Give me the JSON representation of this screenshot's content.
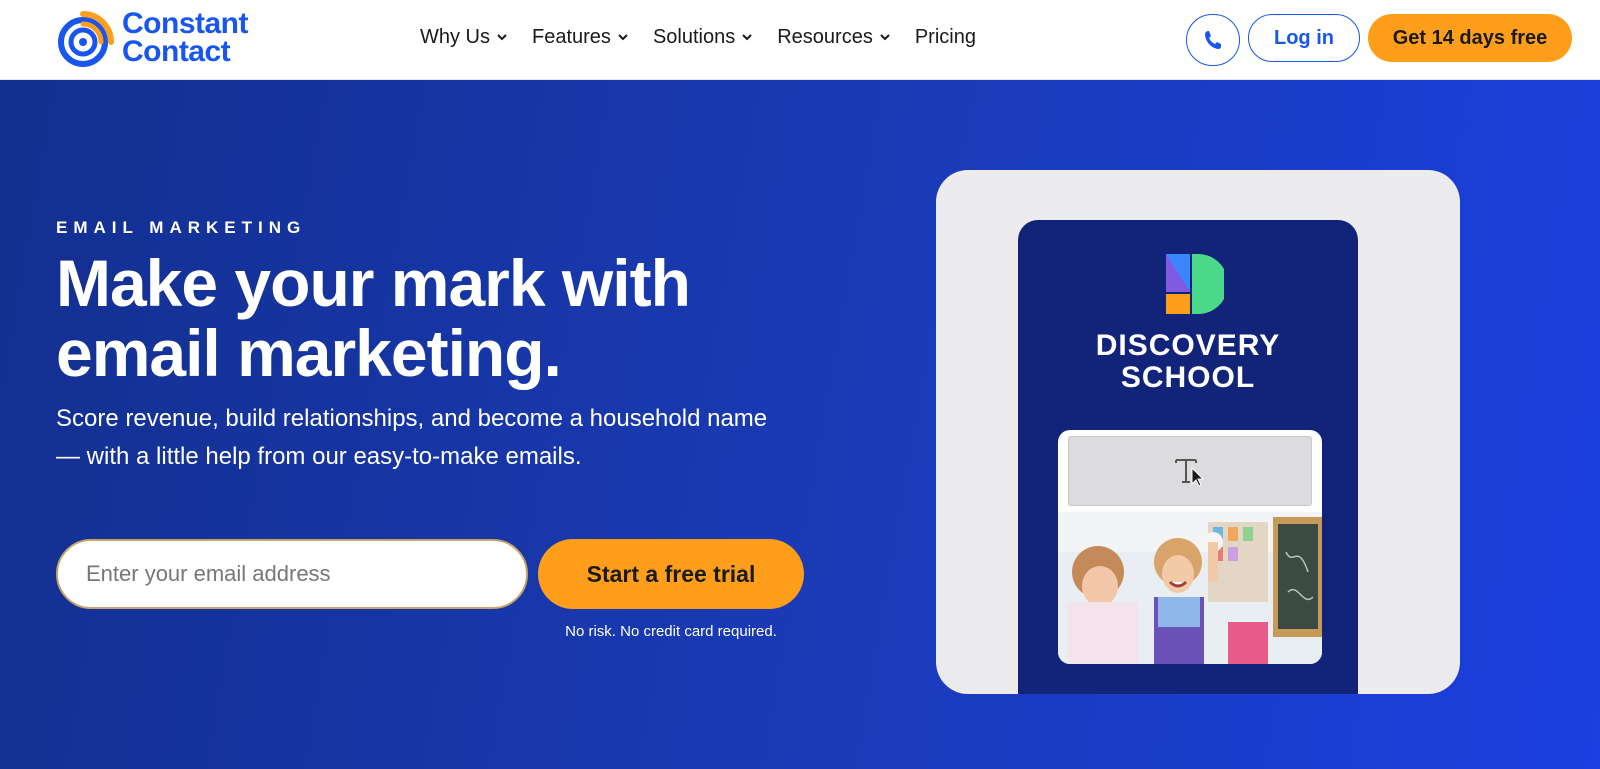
{
  "header": {
    "logo": {
      "line1": "Constant",
      "line2": "Contact",
      "brand_color": "#1856ed"
    },
    "nav": [
      {
        "label": "Why Us",
        "has_dropdown": true
      },
      {
        "label": "Features",
        "has_dropdown": true
      },
      {
        "label": "Solutions",
        "has_dropdown": true
      },
      {
        "label": "Resources",
        "has_dropdown": true
      },
      {
        "label": "Pricing",
        "has_dropdown": false
      }
    ],
    "phone_icon": "phone-icon",
    "login_label": "Log in",
    "cta_label": "Get 14 days free",
    "cta_color": "#ff9e1b"
  },
  "hero": {
    "eyebrow": "EMAIL MARKETING",
    "headline": "Make your mark with email marketing.",
    "subhead": "Score revenue, build relationships, and become a household name — with a little help from our easy-to-make emails.",
    "email_placeholder": "Enter your email address",
    "start_label": "Start a free trial",
    "disclaimer": "No risk. No credit card required.",
    "background_color": "#1a3bb8"
  },
  "preview": {
    "school_line1": "DISCOVERY",
    "school_line2": "SCHOOL",
    "text_tool_icon": "text-cursor-icon",
    "photo": "children-painting-photo"
  }
}
